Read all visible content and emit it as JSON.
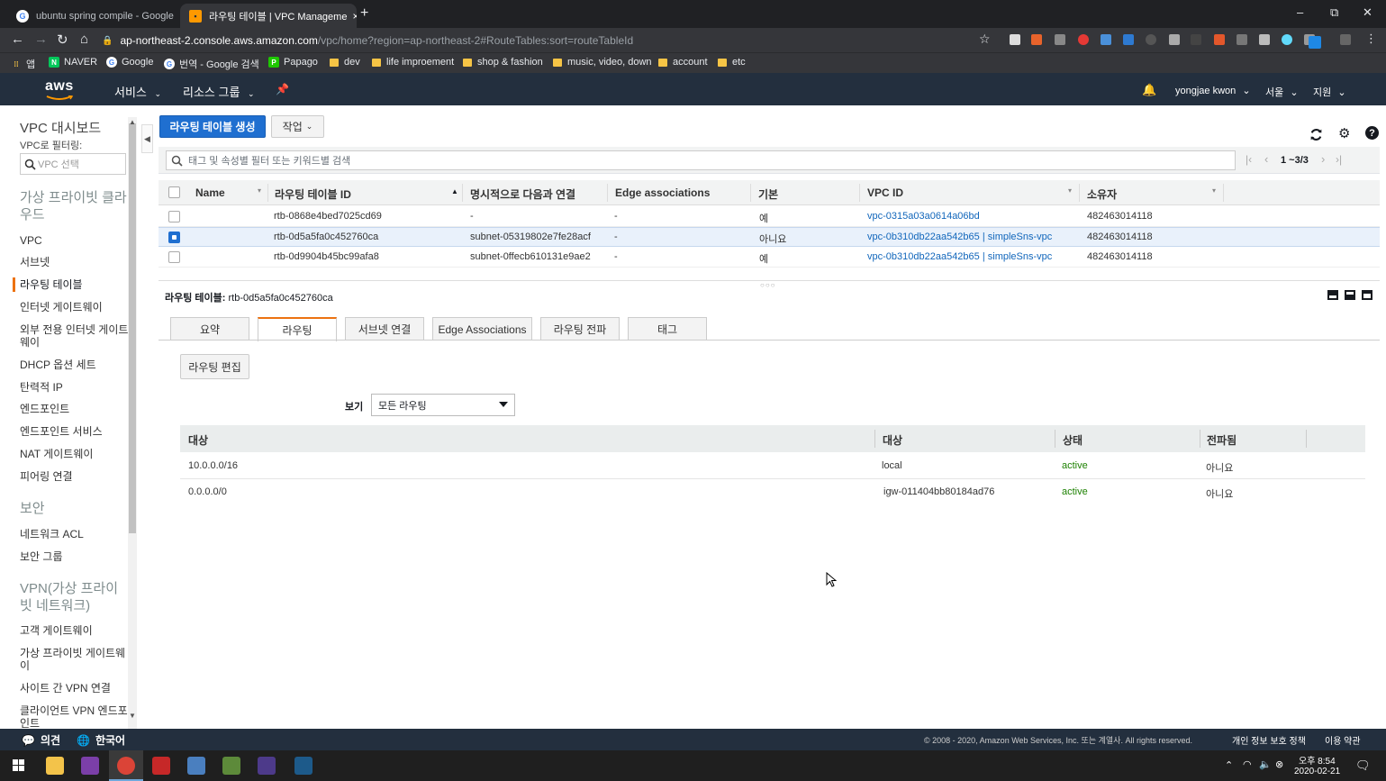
{
  "browser": {
    "tabs": [
      {
        "title": "ubuntu spring compile - Google",
        "active": false
      },
      {
        "title": "라우팅 테이블 | VPC Manageme",
        "active": true
      }
    ],
    "new_tab": "+",
    "close": "×",
    "minimize": "–",
    "maximize": "⧉",
    "window_close": "✕",
    "url_host": "ap-northeast-2.console.aws.amazon.com",
    "url_path": "/vpc/home?region=ap-northeast-2#RouteTables:sort=routeTableId",
    "bookmarks": [
      {
        "label": "앱",
        "type": "apps"
      },
      {
        "label": "NAVER",
        "type": "naver"
      },
      {
        "label": "Google",
        "type": "google"
      },
      {
        "label": "번역 - Google 검색",
        "type": "google"
      },
      {
        "label": "Papago",
        "type": "papago"
      },
      {
        "label": "dev",
        "type": "folder"
      },
      {
        "label": "life improement",
        "type": "folder"
      },
      {
        "label": "shop & fashion",
        "type": "folder"
      },
      {
        "label": "music, video, down",
        "type": "folder"
      },
      {
        "label": "account",
        "type": "folder"
      },
      {
        "label": "etc",
        "type": "folder"
      }
    ]
  },
  "aws_header": {
    "logo": "aws",
    "services": "서비스",
    "resource_groups": "리소스 그룹",
    "user": "yongjae kwon",
    "region": "서울",
    "support": "지원"
  },
  "sidebar": {
    "dashboard": "VPC 대시보드",
    "filter_label": "VPC로 필터링:",
    "filter_placeholder": "VPC 선택",
    "section_vpc": "가상 프라이빗 클라우드",
    "items_vpc": [
      "VPC",
      "서브넷",
      "라우팅 테이블",
      "인터넷 게이트웨이",
      "외부 전용 인터넷 게이트웨이",
      "DHCP 옵션 세트",
      "탄력적 IP",
      "엔드포인트",
      "엔드포인트 서비스",
      "NAT 게이트웨이",
      "피어링 연결"
    ],
    "active_item": "라우팅 테이블",
    "section_security": "보안",
    "items_security": [
      "네트워크 ACL",
      "보안 그룹"
    ],
    "section_vpn": "VPN(가상 프라이빗 네트워크)",
    "items_vpn": [
      "고객 게이트웨이",
      "가상 프라이빗 게이트웨이",
      "사이트 간 VPN 연결",
      "클라이언트 VPN 엔드포인트"
    ]
  },
  "toolbar": {
    "create_label": "라우팅 테이블 생성",
    "actions_label": "작업",
    "refresh_icon": "refresh-icon",
    "settings_icon": "gear-icon",
    "help_icon": "help-icon"
  },
  "filter": {
    "placeholder": "태그 및 속성별 필터 또는 키워드별 검색",
    "pagination": "1 ~3/3"
  },
  "table": {
    "columns": [
      "Name",
      "라우팅 테이블 ID",
      "명시적으로 다음과 연결",
      "Edge associations",
      "기본",
      "VPC ID",
      "소유자"
    ],
    "rows": [
      {
        "name": "",
        "id": "rtb-0868e4bed7025cd69",
        "explicit": "-",
        "edge": "-",
        "main": "예",
        "vpc": "vpc-0315a03a0614a06bd",
        "owner": "482463014118",
        "selected": false
      },
      {
        "name": "",
        "id": "rtb-0d5a5fa0c452760ca",
        "explicit": "subnet-05319802e7fe28acf",
        "edge": "-",
        "main": "아니요",
        "vpc": "vpc-0b310db22aa542b65 | simpleSns-vpc",
        "owner": "482463014118",
        "selected": true
      },
      {
        "name": "",
        "id": "rtb-0d9904b45bc99afa8",
        "explicit": "subnet-0ffecb610131e9ae2",
        "edge": "-",
        "main": "예",
        "vpc": "vpc-0b310db22aa542b65 | simpleSns-vpc",
        "owner": "482463014118",
        "selected": false
      }
    ]
  },
  "detail": {
    "title_label": "라우팅 테이블:",
    "title_value": "rtb-0d5a5fa0c452760ca",
    "tabs": [
      "요약",
      "라우팅",
      "서브넷 연결",
      "Edge Associations",
      "라우팅 전파",
      "태그"
    ],
    "active_tab": "라우팅",
    "edit_button": "라우팅 편집",
    "view_label": "보기",
    "view_value": "모든 라우팅",
    "routes_columns": [
      "대상",
      "대상",
      "상태",
      "전파됨"
    ],
    "routes": [
      {
        "destination": "10.0.0.0/16",
        "target": "local",
        "status": "active",
        "propagated": "아니요"
      },
      {
        "destination": "0.0.0.0/0",
        "target": "igw-011404bb80184ad76",
        "status": "active",
        "propagated": "아니요"
      }
    ]
  },
  "footer": {
    "feedback": "의견",
    "language": "한국어",
    "copyright": "© 2008 - 2020, Amazon Web Services, Inc. 또는 계열사. All rights reserved.",
    "privacy": "개인 정보 보호 정책",
    "terms": "이용 약관"
  },
  "taskbar": {
    "time": "오후 8:54",
    "date": "2020-02-21"
  },
  "colors": {
    "aws_header": "#232f3e",
    "primary_button": "#1f6fd0",
    "active_orange": "#ec7211",
    "status_green": "#1d8102",
    "link_blue": "#1166bb"
  }
}
